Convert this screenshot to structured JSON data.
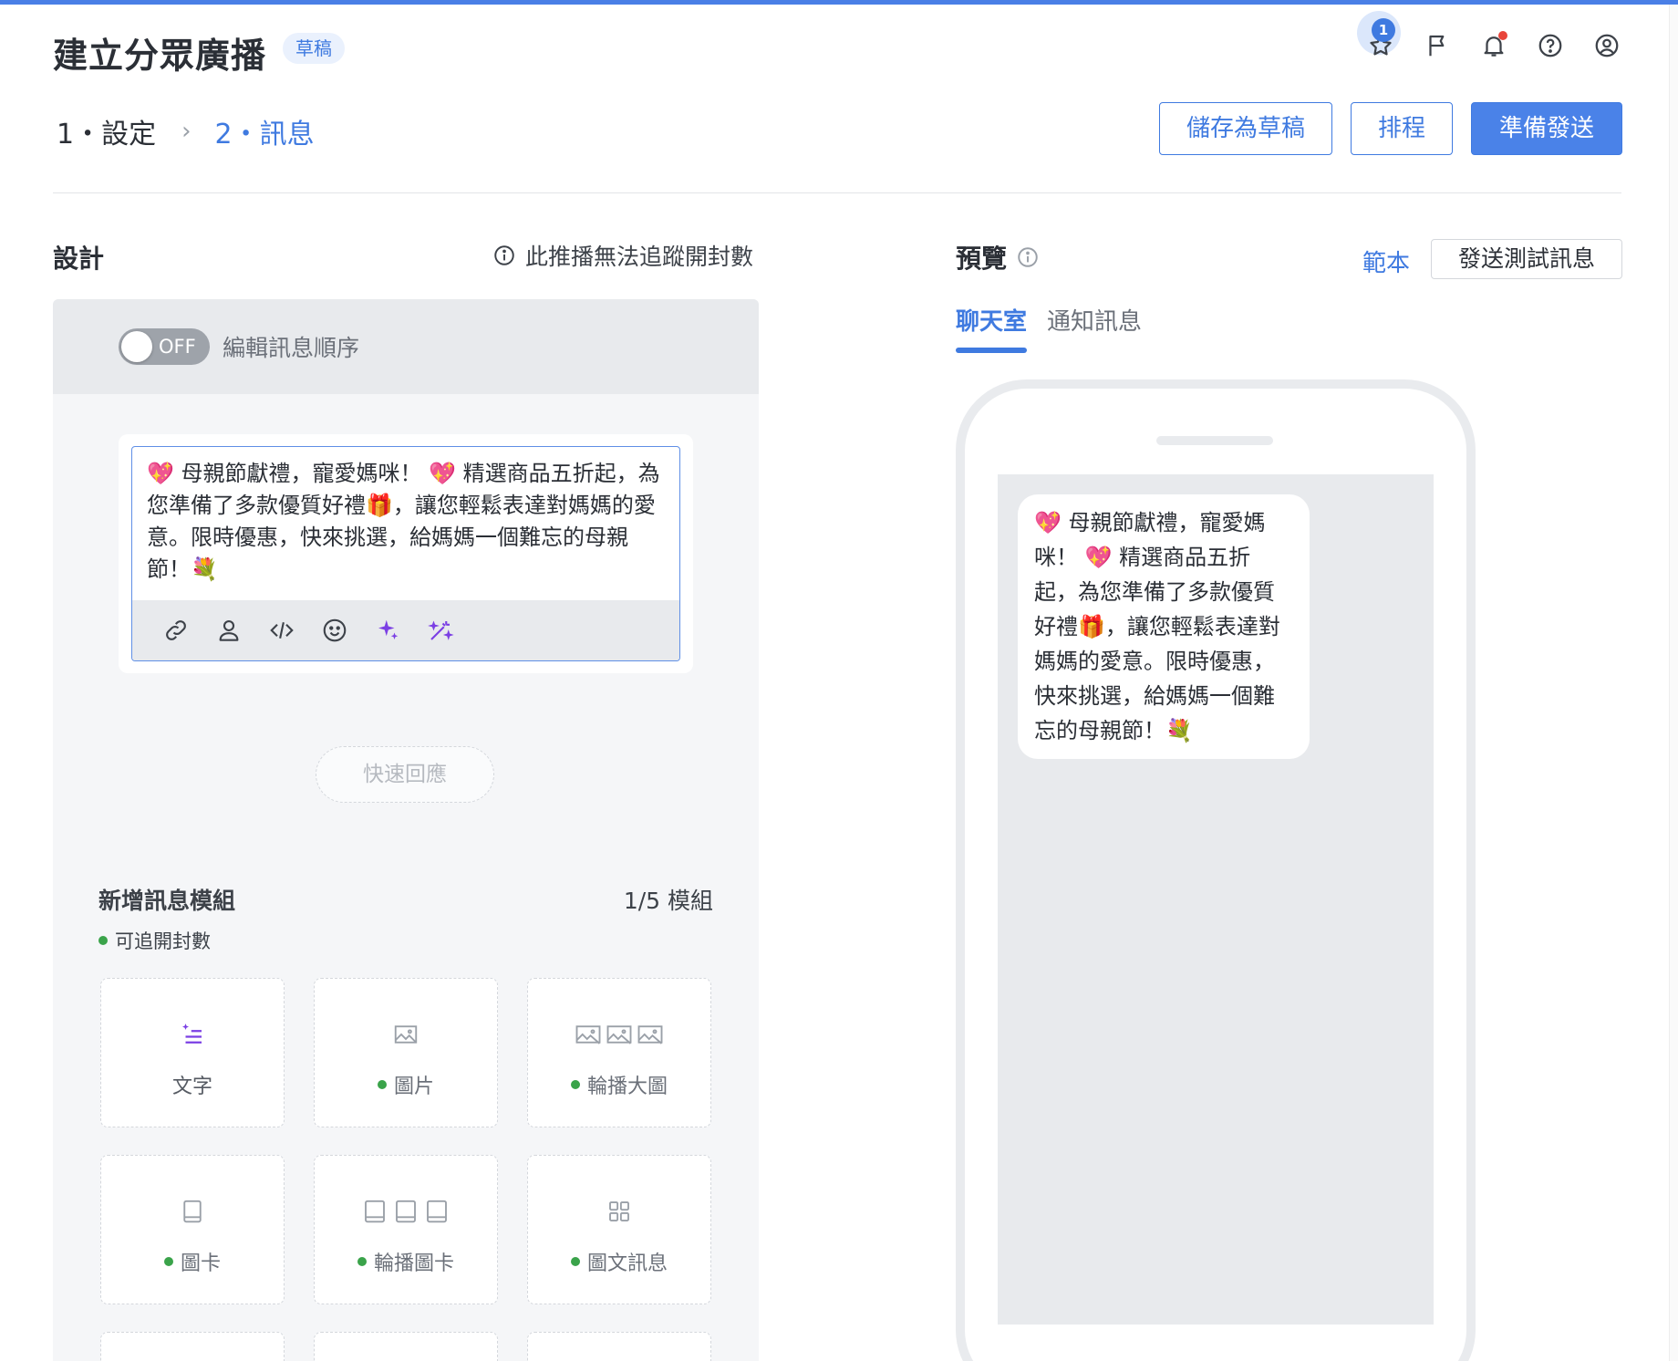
{
  "header": {
    "title": "建立分眾廣播",
    "badge": "草稿",
    "star_count": "1"
  },
  "steps": {
    "step1": "1・設定",
    "separator": "›",
    "step2": "2・訊息"
  },
  "actions": {
    "save_draft": "儲存為草稿",
    "schedule": "排程",
    "send": "準備發送"
  },
  "design": {
    "title": "設計",
    "track_note": "此推播無法追蹤開封數",
    "toggle_state": "OFF",
    "toggle_label": "編輯訊息順序",
    "message_text": "💖 母親節獻禮，寵愛媽咪！ 💖 精選商品五折起，為您準備了多款優質好禮🎁，讓您輕鬆表達對媽媽的愛意。限時優惠，快來挑選，給媽媽一個難忘的母親節！💐",
    "quick_reply": "快速回應",
    "add_module_title": "新增訊息模組",
    "module_count": "1/5 模組",
    "trackable_note": "可追開封數",
    "modules": [
      {
        "label": "文字",
        "icon": "text-icon",
        "trackable": false
      },
      {
        "label": "圖片",
        "icon": "image-icon",
        "trackable": true
      },
      {
        "label": "輪播大圖",
        "icon": "carousel-image-icon",
        "trackable": true
      },
      {
        "label": "圖卡",
        "icon": "card-icon",
        "trackable": true
      },
      {
        "label": "輪播圖卡",
        "icon": "carousel-card-icon",
        "trackable": true
      },
      {
        "label": "圖文訊息",
        "icon": "grid-icon",
        "trackable": true
      }
    ]
  },
  "preview": {
    "title": "預覽",
    "template_link": "範本",
    "test_button": "發送測試訊息",
    "tabs": [
      "聊天室",
      "通知訊息"
    ],
    "active_tab": "聊天室",
    "bubble_text": "💖 母親節獻禮，寵愛媽咪！ 💖 精選商品五折起，為您準備了多款優質好禮🎁，讓您輕鬆表達對媽媽的愛意。限時優惠，快來挑選，給媽媽一個難忘的母親節！💐"
  },
  "colors": {
    "accent": "#3f7ae0",
    "green_dot": "#3aa34a",
    "notification_dot": "#e8443a",
    "ai_purple": "#7b3fe4"
  }
}
